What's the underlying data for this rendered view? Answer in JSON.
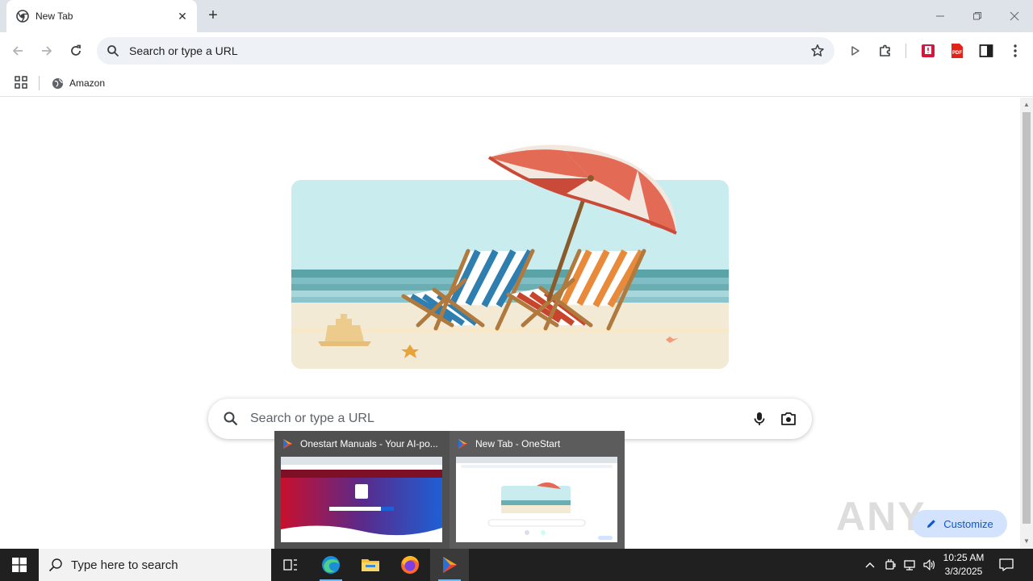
{
  "browser": {
    "tab": {
      "title": "New Tab"
    },
    "omnibox": {
      "placeholder": "Search or type a URL"
    },
    "bookmarks": [
      {
        "label": "Amazon"
      }
    ]
  },
  "newtab_page": {
    "search": {
      "placeholder": "Search or type a URL"
    },
    "customize_label": "Customize",
    "watermark": "ANY RUN"
  },
  "taskbar_previews": [
    {
      "title": "Onestart Manuals - Your AI-po...",
      "hot": false
    },
    {
      "title": "New Tab - OneStart",
      "hot": true
    }
  ],
  "taskbar": {
    "search_placeholder": "Type here to search",
    "clock": {
      "time": "10:25 AM",
      "date": "3/3/2025"
    }
  },
  "colors": {
    "accent": "#0b57d0",
    "titlebar": "#dee3ea",
    "taskbar": "#202020"
  }
}
